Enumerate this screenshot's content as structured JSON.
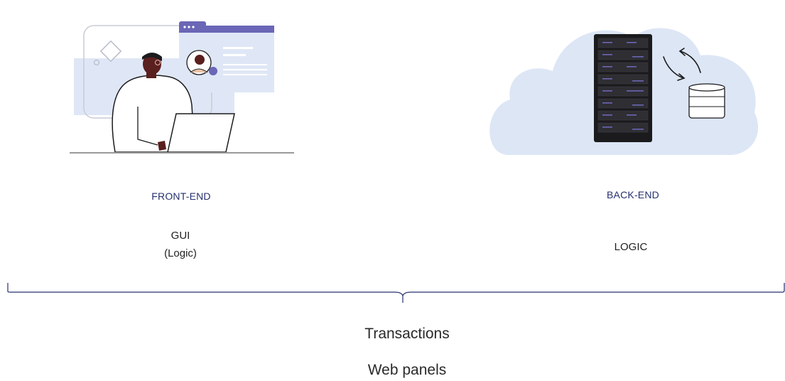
{
  "colors": {
    "accent": "#25306e",
    "illustration_purple": "#6b66b6",
    "cloud": "#dde6f5",
    "panel": "#dfe7f6",
    "server": "#1b1b1d",
    "text": "#1f1f1f"
  },
  "front_end": {
    "heading": "FRONT-END",
    "lines": [
      "GUI",
      "(Logic)"
    ],
    "illustration": "person-at-laptop-with-ui-window"
  },
  "back_end": {
    "heading": "BACK-END",
    "lines": [
      "LOGIC"
    ],
    "illustration": "server-rack-and-database-in-cloud"
  },
  "footer": {
    "items": [
      "Transactions",
      "Web panels"
    ]
  }
}
